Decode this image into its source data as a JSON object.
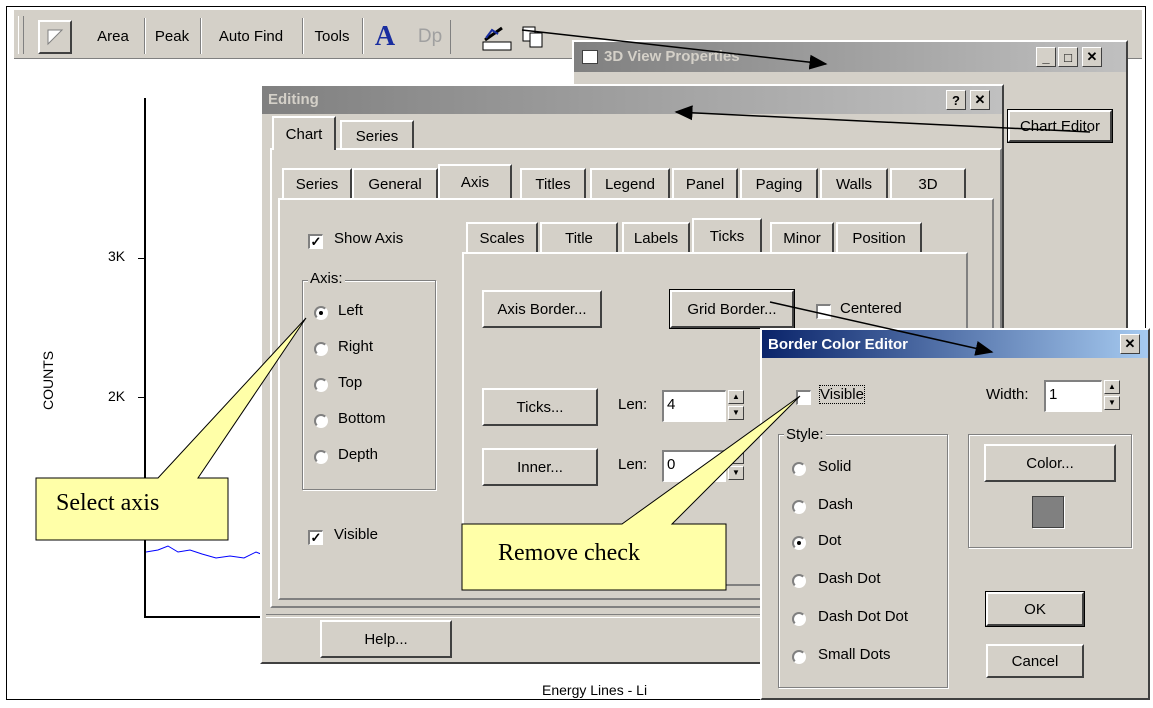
{
  "toolbar": {
    "items": [
      "Area",
      "Peak",
      "Auto Find",
      "Tools"
    ],
    "dp_label": "Dp"
  },
  "chart": {
    "ylabel": "COUNTS",
    "yticks": [
      "3K",
      "2K"
    ],
    "xlabel_partial": "Energy Lines - Li"
  },
  "view_props": {
    "title": "3D View Properties",
    "chart_editor_button": "Chart Editor"
  },
  "editing": {
    "title": "Editing",
    "outer_tabs": [
      "Chart",
      "Series"
    ],
    "inner_tabs": [
      "Series",
      "General",
      "Axis",
      "Titles",
      "Legend",
      "Panel",
      "Paging",
      "Walls",
      "3D"
    ],
    "show_axis": "Show Axis",
    "axis_group_title": "Axis:",
    "axis_options": [
      "Left",
      "Right",
      "Top",
      "Bottom",
      "Depth"
    ],
    "visible": "Visible",
    "sub_tabs": [
      "Scales",
      "Title",
      "Labels",
      "Ticks",
      "Minor",
      "Position"
    ],
    "axis_border_button": "Axis Border...",
    "grid_border_button": "Grid Border...",
    "centered": "Centered",
    "ticks_button": "Ticks...",
    "inner_button": "Inner...",
    "len_label": "Len:",
    "ticks_len": "4",
    "inner_len": "0",
    "help_button": "Help..."
  },
  "border_editor": {
    "title": "Border Color Editor",
    "visible": "Visible",
    "width_label": "Width:",
    "width_value": "1",
    "style_group_title": "Style:",
    "style_options": [
      "Solid",
      "Dash",
      "Dot",
      "Dash Dot",
      "Dash Dot Dot",
      "Small Dots"
    ],
    "selected_style": "Dot",
    "color_button": "Color...",
    "color_swatch": "#808080",
    "ok_button": "OK",
    "cancel_button": "Cancel"
  },
  "callouts": {
    "select_axis": "Select axis",
    "remove_check": "Remove check"
  },
  "colors": {
    "dialog_face": "#d4d0c8",
    "active_title": "#0a246a",
    "inactive_title": "#808080",
    "callout_fill": "#ffffa8",
    "plot_line": "#0000ff"
  }
}
